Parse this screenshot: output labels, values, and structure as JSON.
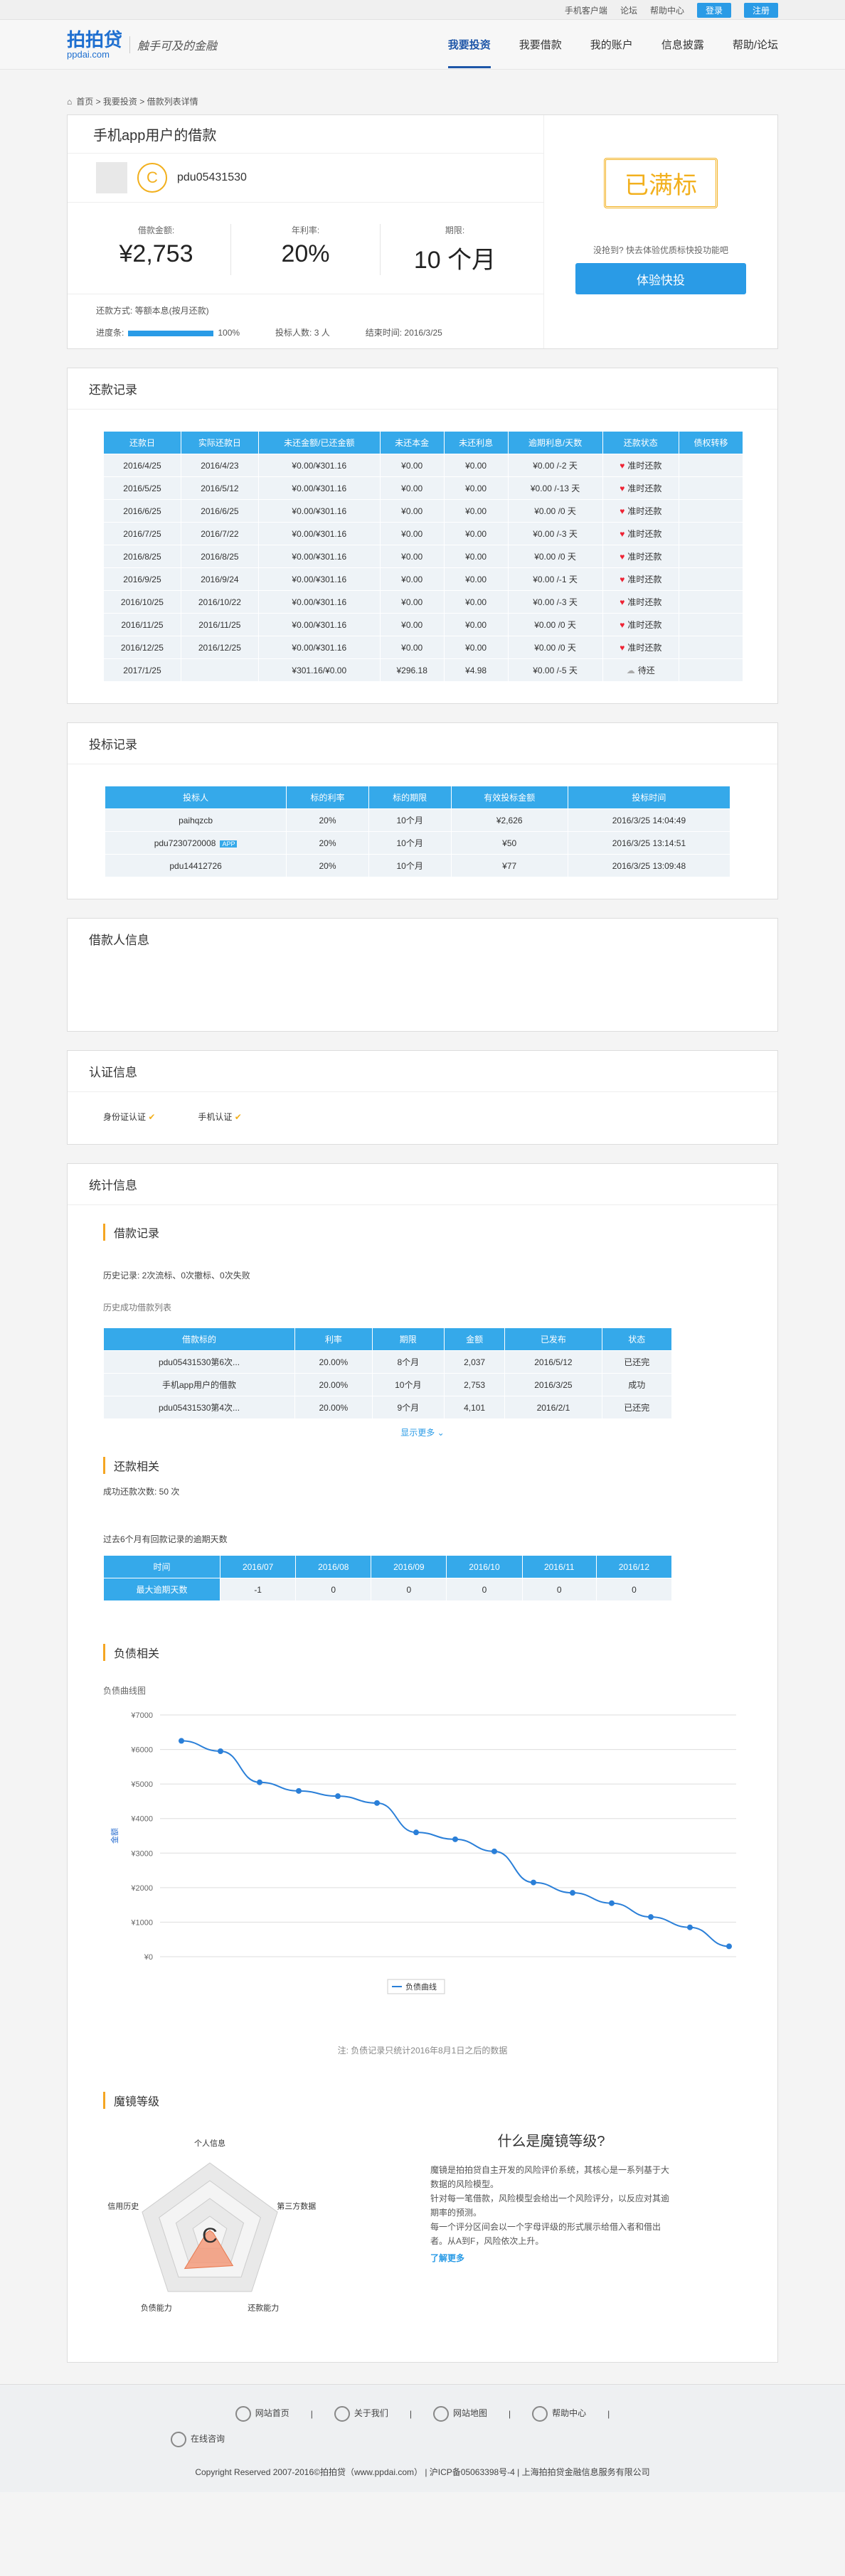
{
  "topbar": {
    "app": "手机客户端",
    "forum": "论坛",
    "help": "帮助中心",
    "login": "登录",
    "register": "注册"
  },
  "logo": {
    "mark": "拍拍贷",
    "domain": "ppdai.com",
    "slogan": "触手可及的金融"
  },
  "nav": [
    "我要投资",
    "我要借款",
    "我的账户",
    "信息披露",
    "帮助/论坛"
  ],
  "breadcrumb": "首页 > 我要投资 > 借款列表详情",
  "loan": {
    "title": "手机app用户的借款",
    "coin": "C",
    "user": "pdu05431530",
    "amount_label": "借款金额:",
    "amount": "¥2,753",
    "rate_label": "年利率:",
    "rate": "20%",
    "term_label": "期限:",
    "term": "10 个月",
    "repay": "还款方式: 等额本息(按月还款)",
    "progress_label": "进度条:",
    "progress_pct": "100%",
    "progress_value": 1.0,
    "investors": "投标人数: 3 人",
    "end": "结束时间: 2016/3/25",
    "status": "已满标",
    "hint": "没抢到? 快去体验优质标快投功能吧",
    "btn": "体验快投"
  },
  "repay_title": "还款记录",
  "repay_headers": [
    "还款日",
    "实际还款日",
    "未还金额/已还金额",
    "未还本金",
    "未还利息",
    "逾期利息/天数",
    "还款状态",
    "债权转移"
  ],
  "repay_rows": [
    [
      "2016/4/25",
      "2016/4/23",
      "¥0.00/¥301.16",
      "¥0.00",
      "¥0.00",
      "¥0.00 /-2 天",
      "准时还款",
      ""
    ],
    [
      "2016/5/25",
      "2016/5/12",
      "¥0.00/¥301.16",
      "¥0.00",
      "¥0.00",
      "¥0.00 /-13 天",
      "准时还款",
      ""
    ],
    [
      "2016/6/25",
      "2016/6/25",
      "¥0.00/¥301.16",
      "¥0.00",
      "¥0.00",
      "¥0.00 /0 天",
      "准时还款",
      ""
    ],
    [
      "2016/7/25",
      "2016/7/22",
      "¥0.00/¥301.16",
      "¥0.00",
      "¥0.00",
      "¥0.00 /-3 天",
      "准时还款",
      ""
    ],
    [
      "2016/8/25",
      "2016/8/25",
      "¥0.00/¥301.16",
      "¥0.00",
      "¥0.00",
      "¥0.00 /0 天",
      "准时还款",
      ""
    ],
    [
      "2016/9/25",
      "2016/9/24",
      "¥0.00/¥301.16",
      "¥0.00",
      "¥0.00",
      "¥0.00 /-1 天",
      "准时还款",
      ""
    ],
    [
      "2016/10/25",
      "2016/10/22",
      "¥0.00/¥301.16",
      "¥0.00",
      "¥0.00",
      "¥0.00 /-3 天",
      "准时还款",
      ""
    ],
    [
      "2016/11/25",
      "2016/11/25",
      "¥0.00/¥301.16",
      "¥0.00",
      "¥0.00",
      "¥0.00 /0 天",
      "准时还款",
      ""
    ],
    [
      "2016/12/25",
      "2016/12/25",
      "¥0.00/¥301.16",
      "¥0.00",
      "¥0.00",
      "¥0.00 /0 天",
      "准时还款",
      ""
    ],
    [
      "2017/1/25",
      "",
      "¥301.16/¥0.00",
      "¥296.18",
      "¥4.98",
      "¥0.00 /-5 天",
      "待还",
      ""
    ]
  ],
  "bid_title": "投标记录",
  "bid_headers": [
    "投标人",
    "标的利率",
    "标的期限",
    "有效投标金额",
    "投标时间"
  ],
  "bid_rows": [
    [
      "paihqzcb",
      "20%",
      "10个月",
      "¥2,626",
      "2016/3/25 14:04:49"
    ],
    [
      "pdu7230720008",
      "20%",
      "10个月",
      "¥50",
      "2016/3/25 13:14:51"
    ],
    [
      "pdu14412726",
      "20%",
      "10个月",
      "¥77",
      "2016/3/25 13:09:48"
    ]
  ],
  "bid_app_tag": "APP",
  "borrower_title": "借款人信息",
  "cert_title": "认证信息",
  "cert": [
    "身份证认证",
    "手机认证"
  ],
  "stat_title": "统计信息",
  "loan_rec": {
    "title": "借款记录",
    "history": "历史记录:   2次流标、0次撤标、0次失败",
    "list_label": "历史成功借款列表",
    "headers": [
      "借款标的",
      "利率",
      "期限",
      "金额",
      "已发布",
      "状态"
    ],
    "rows": [
      [
        "pdu05431530第6次...",
        "20.00%",
        "8个月",
        "2,037",
        "2016/5/12",
        "已还完"
      ],
      [
        "手机app用户的借款",
        "20.00%",
        "10个月",
        "2,753",
        "2016/3/25",
        "成功"
      ],
      [
        "pdu05431530第4次...",
        "20.00%",
        "9个月",
        "4,101",
        "2016/2/1",
        "已还完"
      ]
    ],
    "more": "显示更多"
  },
  "repay_rel": {
    "title": "还款相关",
    "count": "成功还款次数:  50 次",
    "overdue_label": "过去6个月有回款记录的逾期天数",
    "headers": [
      "时间",
      "2016/07",
      "2016/08",
      "2016/09",
      "2016/10",
      "2016/11",
      "2016/12"
    ],
    "row": [
      "最大逾期天数",
      "-1",
      "0",
      "0",
      "0",
      "0",
      "0"
    ]
  },
  "debt": {
    "title": "负债相关",
    "chart_label": "负债曲线图",
    "legend": "负债曲线",
    "note": "注: 负债记录只统计2016年8月1日之后的数据"
  },
  "chart_data": {
    "type": "line",
    "title": "负债曲线图",
    "ylabel": "金额",
    "series": [
      {
        "name": "负债曲线",
        "values": [
          6250,
          5950,
          5050,
          4800,
          4650,
          4450,
          3600,
          3400,
          3050,
          2150,
          1850,
          1550,
          1150,
          850,
          300
        ]
      }
    ],
    "ylim": [
      0,
      7000
    ],
    "yticks": [
      "¥0",
      "¥1000",
      "¥2000",
      "¥3000",
      "¥4000",
      "¥5000",
      "¥6000",
      "¥7000"
    ],
    "grid": true,
    "legend_position": "bottom-center"
  },
  "mirror": {
    "title": "魔镜等级",
    "grade": "C",
    "axes": [
      "个人信息",
      "第三方数据",
      "还款能力",
      "负债能力",
      "信用历史"
    ],
    "q": "什么是魔镜等级?",
    "desc": [
      "魔镜是拍拍贷自主开发的风险评价系统，其核心是一系列基于大数据的风险模型。",
      "针对每一笔借款，风险模型会给出一个风险评分，以反应对其逾期率的预测。",
      "每一个评分区间会以一个字母评级的形式展示给借入者和借出者。从A到F，风险依次上升。"
    ],
    "more": "了解更多",
    "values": [
      0.05,
      0.05,
      0.55,
      0.6,
      0.05
    ]
  },
  "footer": {
    "links": [
      "网站首页",
      "关于我们",
      "网站地图",
      "帮助中心",
      "在线咨询"
    ],
    "copy": "Copyright Reserved 2007-2016©拍拍贷（www.ppdai.com）   |   沪ICP备05063398号-4   |   上海拍拍贷金融信息服务有限公司"
  }
}
